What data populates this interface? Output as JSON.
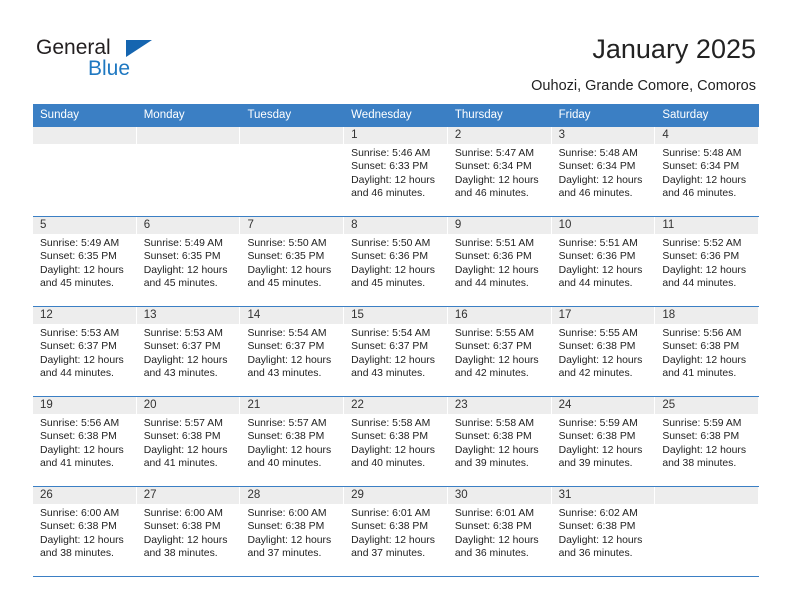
{
  "brand": {
    "name_part1": "General",
    "name_part2": "Blue",
    "accent_color": "#1565b0",
    "text_color": "#231f20"
  },
  "header": {
    "title": "January 2025",
    "subtitle": "Ouhozi, Grande Comore, Comoros"
  },
  "theme": {
    "header_bg": "#3b7fc4",
    "date_band_bg": "#ededed",
    "row_divider": "#3b7fc4"
  },
  "calendar": {
    "weekdays": [
      "Sunday",
      "Monday",
      "Tuesday",
      "Wednesday",
      "Thursday",
      "Friday",
      "Saturday"
    ],
    "weeks": [
      [
        {
          "day": "",
          "empty": true,
          "line1": "",
          "line2": "",
          "line3": "",
          "line4": ""
        },
        {
          "day": "",
          "empty": true,
          "line1": "",
          "line2": "",
          "line3": "",
          "line4": ""
        },
        {
          "day": "",
          "empty": true,
          "line1": "",
          "line2": "",
          "line3": "",
          "line4": ""
        },
        {
          "day": "1",
          "line1": "Sunrise: 5:46 AM",
          "line2": "Sunset: 6:33 PM",
          "line3": "Daylight: 12 hours",
          "line4": "and 46 minutes."
        },
        {
          "day": "2",
          "line1": "Sunrise: 5:47 AM",
          "line2": "Sunset: 6:34 PM",
          "line3": "Daylight: 12 hours",
          "line4": "and 46 minutes."
        },
        {
          "day": "3",
          "line1": "Sunrise: 5:48 AM",
          "line2": "Sunset: 6:34 PM",
          "line3": "Daylight: 12 hours",
          "line4": "and 46 minutes."
        },
        {
          "day": "4",
          "line1": "Sunrise: 5:48 AM",
          "line2": "Sunset: 6:34 PM",
          "line3": "Daylight: 12 hours",
          "line4": "and 46 minutes."
        }
      ],
      [
        {
          "day": "5",
          "line1": "Sunrise: 5:49 AM",
          "line2": "Sunset: 6:35 PM",
          "line3": "Daylight: 12 hours",
          "line4": "and 45 minutes."
        },
        {
          "day": "6",
          "line1": "Sunrise: 5:49 AM",
          "line2": "Sunset: 6:35 PM",
          "line3": "Daylight: 12 hours",
          "line4": "and 45 minutes."
        },
        {
          "day": "7",
          "line1": "Sunrise: 5:50 AM",
          "line2": "Sunset: 6:35 PM",
          "line3": "Daylight: 12 hours",
          "line4": "and 45 minutes."
        },
        {
          "day": "8",
          "line1": "Sunrise: 5:50 AM",
          "line2": "Sunset: 6:36 PM",
          "line3": "Daylight: 12 hours",
          "line4": "and 45 minutes."
        },
        {
          "day": "9",
          "line1": "Sunrise: 5:51 AM",
          "line2": "Sunset: 6:36 PM",
          "line3": "Daylight: 12 hours",
          "line4": "and 44 minutes."
        },
        {
          "day": "10",
          "line1": "Sunrise: 5:51 AM",
          "line2": "Sunset: 6:36 PM",
          "line3": "Daylight: 12 hours",
          "line4": "and 44 minutes."
        },
        {
          "day": "11",
          "line1": "Sunrise: 5:52 AM",
          "line2": "Sunset: 6:36 PM",
          "line3": "Daylight: 12 hours",
          "line4": "and 44 minutes."
        }
      ],
      [
        {
          "day": "12",
          "line1": "Sunrise: 5:53 AM",
          "line2": "Sunset: 6:37 PM",
          "line3": "Daylight: 12 hours",
          "line4": "and 44 minutes."
        },
        {
          "day": "13",
          "line1": "Sunrise: 5:53 AM",
          "line2": "Sunset: 6:37 PM",
          "line3": "Daylight: 12 hours",
          "line4": "and 43 minutes."
        },
        {
          "day": "14",
          "line1": "Sunrise: 5:54 AM",
          "line2": "Sunset: 6:37 PM",
          "line3": "Daylight: 12 hours",
          "line4": "and 43 minutes."
        },
        {
          "day": "15",
          "line1": "Sunrise: 5:54 AM",
          "line2": "Sunset: 6:37 PM",
          "line3": "Daylight: 12 hours",
          "line4": "and 43 minutes."
        },
        {
          "day": "16",
          "line1": "Sunrise: 5:55 AM",
          "line2": "Sunset: 6:37 PM",
          "line3": "Daylight: 12 hours",
          "line4": "and 42 minutes."
        },
        {
          "day": "17",
          "line1": "Sunrise: 5:55 AM",
          "line2": "Sunset: 6:38 PM",
          "line3": "Daylight: 12 hours",
          "line4": "and 42 minutes."
        },
        {
          "day": "18",
          "line1": "Sunrise: 5:56 AM",
          "line2": "Sunset: 6:38 PM",
          "line3": "Daylight: 12 hours",
          "line4": "and 41 minutes."
        }
      ],
      [
        {
          "day": "19",
          "line1": "Sunrise: 5:56 AM",
          "line2": "Sunset: 6:38 PM",
          "line3": "Daylight: 12 hours",
          "line4": "and 41 minutes."
        },
        {
          "day": "20",
          "line1": "Sunrise: 5:57 AM",
          "line2": "Sunset: 6:38 PM",
          "line3": "Daylight: 12 hours",
          "line4": "and 41 minutes."
        },
        {
          "day": "21",
          "line1": "Sunrise: 5:57 AM",
          "line2": "Sunset: 6:38 PM",
          "line3": "Daylight: 12 hours",
          "line4": "and 40 minutes."
        },
        {
          "day": "22",
          "line1": "Sunrise: 5:58 AM",
          "line2": "Sunset: 6:38 PM",
          "line3": "Daylight: 12 hours",
          "line4": "and 40 minutes."
        },
        {
          "day": "23",
          "line1": "Sunrise: 5:58 AM",
          "line2": "Sunset: 6:38 PM",
          "line3": "Daylight: 12 hours",
          "line4": "and 39 minutes."
        },
        {
          "day": "24",
          "line1": "Sunrise: 5:59 AM",
          "line2": "Sunset: 6:38 PM",
          "line3": "Daylight: 12 hours",
          "line4": "and 39 minutes."
        },
        {
          "day": "25",
          "line1": "Sunrise: 5:59 AM",
          "line2": "Sunset: 6:38 PM",
          "line3": "Daylight: 12 hours",
          "line4": "and 38 minutes."
        }
      ],
      [
        {
          "day": "26",
          "line1": "Sunrise: 6:00 AM",
          "line2": "Sunset: 6:38 PM",
          "line3": "Daylight: 12 hours",
          "line4": "and 38 minutes."
        },
        {
          "day": "27",
          "line1": "Sunrise: 6:00 AM",
          "line2": "Sunset: 6:38 PM",
          "line3": "Daylight: 12 hours",
          "line4": "and 38 minutes."
        },
        {
          "day": "28",
          "line1": "Sunrise: 6:00 AM",
          "line2": "Sunset: 6:38 PM",
          "line3": "Daylight: 12 hours",
          "line4": "and 37 minutes."
        },
        {
          "day": "29",
          "line1": "Sunrise: 6:01 AM",
          "line2": "Sunset: 6:38 PM",
          "line3": "Daylight: 12 hours",
          "line4": "and 37 minutes."
        },
        {
          "day": "30",
          "line1": "Sunrise: 6:01 AM",
          "line2": "Sunset: 6:38 PM",
          "line3": "Daylight: 12 hours",
          "line4": "and 36 minutes."
        },
        {
          "day": "31",
          "line1": "Sunrise: 6:02 AM",
          "line2": "Sunset: 6:38 PM",
          "line3": "Daylight: 12 hours",
          "line4": "and 36 minutes."
        },
        {
          "day": "",
          "empty": true,
          "line1": "",
          "line2": "",
          "line3": "",
          "line4": ""
        }
      ]
    ]
  }
}
